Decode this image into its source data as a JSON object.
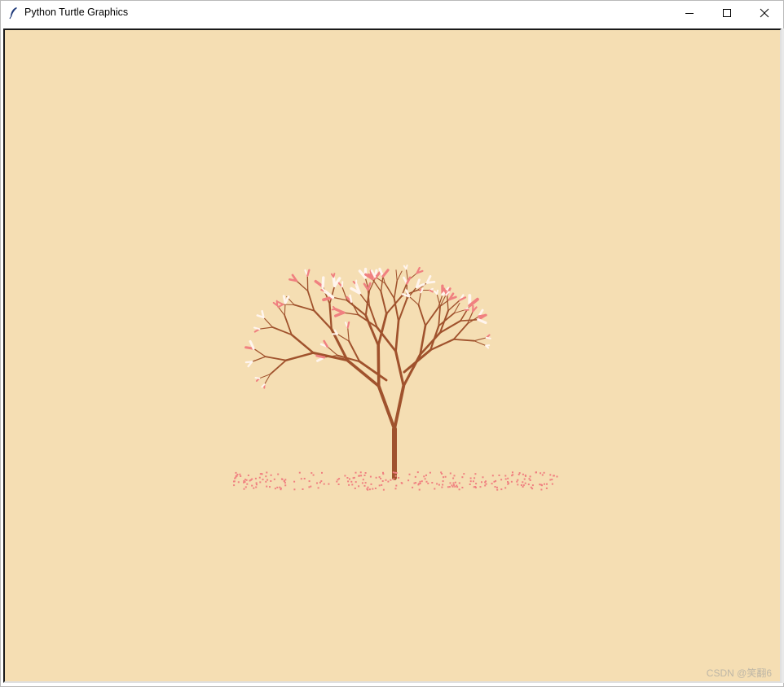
{
  "window": {
    "title": "Python Turtle Graphics",
    "icons": {
      "app": "feather-icon",
      "minimize": "minimize-icon",
      "maximize": "maximize-icon",
      "close": "close-icon"
    }
  },
  "canvas": {
    "background_color": "#f5deb3",
    "trunk_color": "#a0522d",
    "petal_colors": [
      "#f08080",
      "#fff5ee"
    ]
  },
  "watermark": "CSDN @笑翻6"
}
